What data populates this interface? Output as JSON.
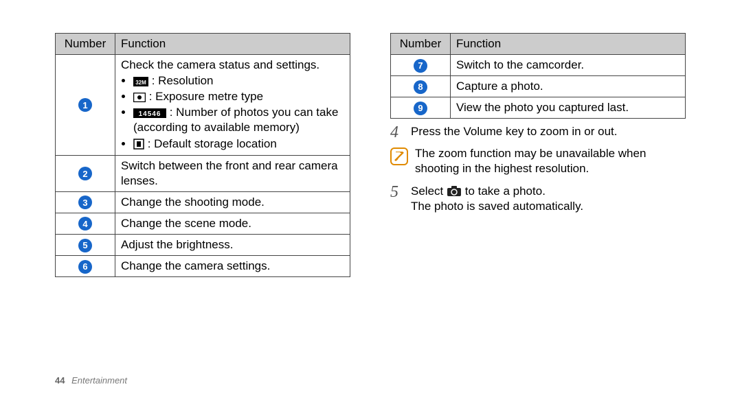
{
  "left_table": {
    "headers": [
      "Number",
      "Function"
    ],
    "rows": [
      {
        "num": "1",
        "function": {
          "lead": "Check the camera status and settings.",
          "items": [
            {
              "icon": "resolution",
              "text": ": Resolution"
            },
            {
              "icon": "exposure",
              "text": ": Exposure metre type"
            },
            {
              "icon": "counter",
              "text": ": Number of photos you can take (according to available memory)"
            },
            {
              "icon": "storage",
              "text": ": Default storage location"
            }
          ]
        }
      },
      {
        "num": "2",
        "function": "Switch between the front and rear camera lenses."
      },
      {
        "num": "3",
        "function": "Change the shooting mode."
      },
      {
        "num": "4",
        "function": "Change the scene mode."
      },
      {
        "num": "5",
        "function": "Adjust the brightness."
      },
      {
        "num": "6",
        "function": "Change the camera settings."
      }
    ]
  },
  "right_table": {
    "headers": [
      "Number",
      "Function"
    ],
    "rows": [
      {
        "num": "7",
        "function": "Switch to the camcorder."
      },
      {
        "num": "8",
        "function": "Capture a photo."
      },
      {
        "num": "9",
        "function": "View the photo you captured last."
      }
    ]
  },
  "step4": {
    "num": "4",
    "text": "Press the Volume key to zoom in or out."
  },
  "note": "The zoom function may be unavailable when shooting in the highest resolution.",
  "step5": {
    "num": "5",
    "text_before": "Select ",
    "text_after": " to take a photo.",
    "line2": "The photo is saved automatically."
  },
  "footer": {
    "page": "44",
    "section": "Entertainment"
  }
}
